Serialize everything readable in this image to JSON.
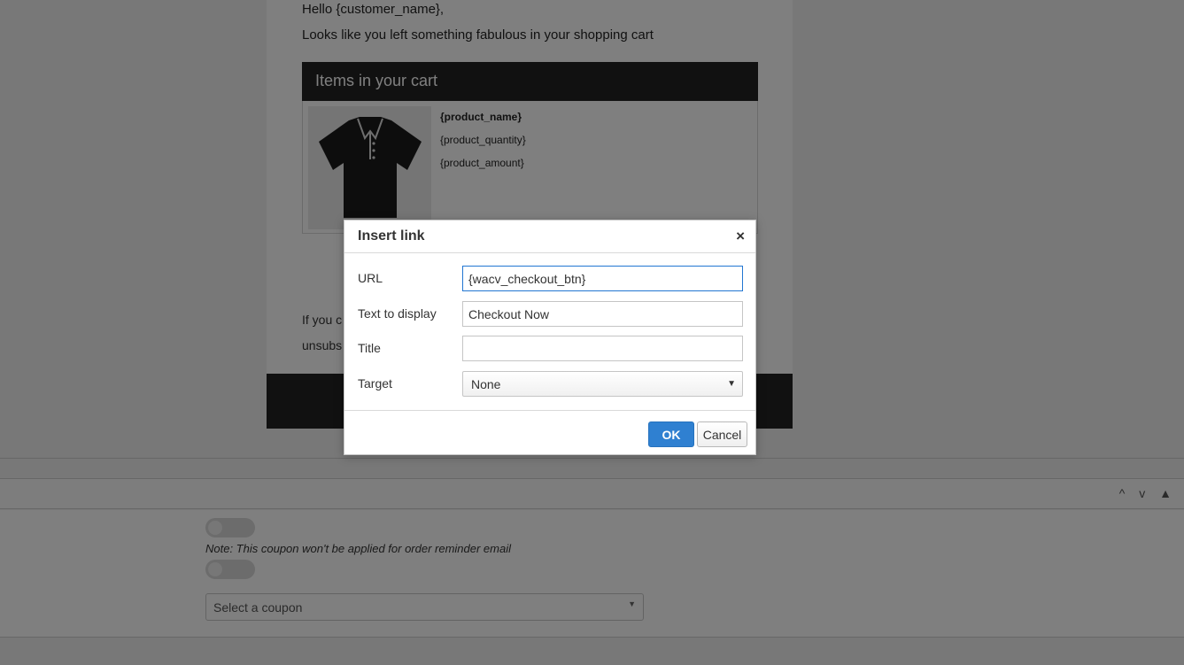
{
  "email": {
    "greeting": "Hello {customer_name},",
    "subline": "Looks like you left something fabulous in your shopping cart",
    "cart_header": "Items in your cart",
    "product": {
      "name": "{product_name}",
      "quantity": "{product_quantity}",
      "amount": "{product_amount}"
    },
    "footnote_fragment_1": "If you c",
    "footnote_fragment_2": "unsubs"
  },
  "panel": {
    "controls": [
      "^",
      "v",
      "▲"
    ],
    "coupon_note": "Note: This coupon won't be applied for order reminder email",
    "coupon_select": {
      "selected": "Select a coupon"
    }
  },
  "dialog": {
    "title": "Insert link",
    "close_glyph": "×",
    "fields": {
      "url": {
        "label": "URL",
        "value": "{wacv_checkout_btn}"
      },
      "text": {
        "label": "Text to display",
        "value": "Checkout Now"
      },
      "title": {
        "label": "Title",
        "value": ""
      },
      "target": {
        "label": "Target",
        "selected": "None"
      }
    },
    "buttons": {
      "ok": "OK",
      "cancel": "Cancel"
    }
  },
  "icons": {
    "product_image": "polo-shirt-icon",
    "select_caret": "caret-down-icon",
    "close": "close-icon"
  },
  "colors": {
    "accent": "#2f80d1",
    "focus_border": "#2276d2",
    "cart_header_bg": "#222222",
    "overlay": "rgba(0,0,0,0.5)"
  }
}
